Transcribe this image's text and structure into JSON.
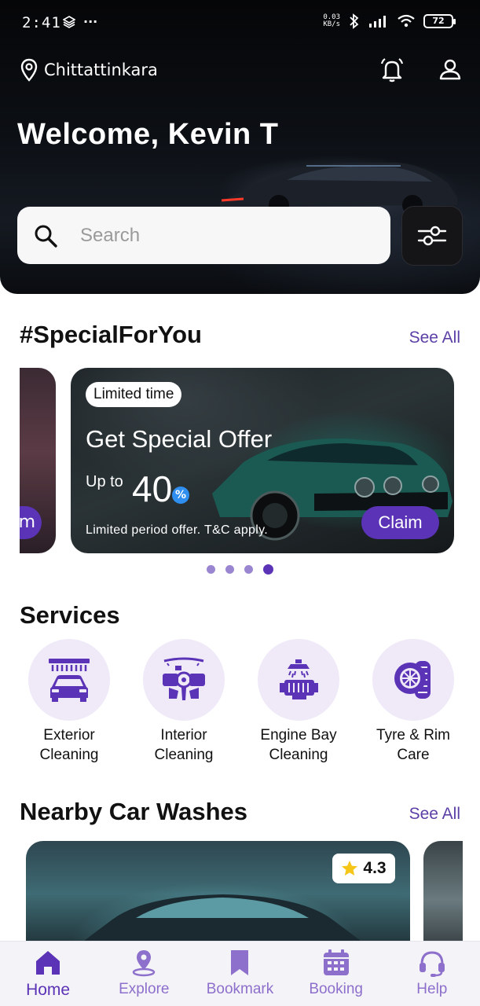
{
  "status_bar": {
    "time": "2:41",
    "more": "···",
    "net_speed_top": "0.03",
    "net_speed_bottom": "KB/s",
    "battery": "72"
  },
  "header": {
    "location": "Chittattinkara",
    "welcome": "Welcome, Kevin T"
  },
  "search": {
    "placeholder": "Search"
  },
  "special": {
    "title": "#SpecialForYou",
    "see_all": "See All",
    "offer": {
      "badge": "Limited time",
      "title": "Get Special Offer",
      "up_to": "Up to",
      "percent": "40",
      "percent_sign": "%",
      "note": "Limited period offer. T&C apply.",
      "claim": "Claim"
    },
    "prev_peek": "m",
    "dots": 4,
    "active_dot": 4
  },
  "services": {
    "title": "Services",
    "items": [
      {
        "label": "Exterior\nCleaning"
      },
      {
        "label": "Interior\nCleaning"
      },
      {
        "label": "Engine Bay\nCleaning"
      },
      {
        "label": "Tyre & Rim\nCare"
      }
    ]
  },
  "nearby": {
    "title": "Nearby Car Washes",
    "see_all": "See All",
    "rating": "4.3"
  },
  "nav": {
    "items": [
      {
        "label": "Home"
      },
      {
        "label": "Explore"
      },
      {
        "label": "Bookmark"
      },
      {
        "label": "Booking"
      },
      {
        "label": "Help"
      }
    ],
    "active": "Home"
  },
  "colors": {
    "accent": "#5b33b6",
    "accent_light": "#efe9f8",
    "nav_inactive": "#8d6fcc",
    "star": "#f5c518"
  }
}
